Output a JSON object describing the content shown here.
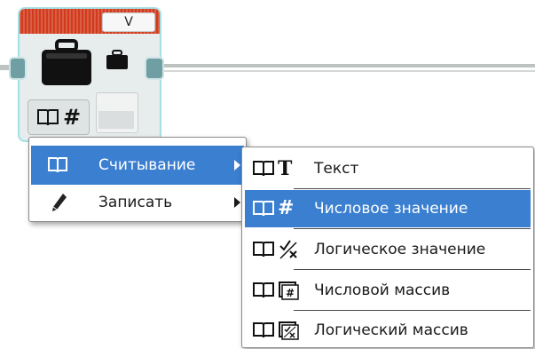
{
  "block": {
    "header_label": "V"
  },
  "menu": {
    "items": [
      {
        "label": "Считывание",
        "icon": "book-icon",
        "has_submenu": true,
        "selected": true
      },
      {
        "label": "Записать",
        "icon": "pencil-icon",
        "has_submenu": true,
        "selected": false
      }
    ]
  },
  "submenu": {
    "items": [
      {
        "label": "Текст",
        "icon": "text-T-icon",
        "selected": false
      },
      {
        "label": "Числовое значение",
        "icon": "hash-icon",
        "selected": true
      },
      {
        "label": "Логическое значение",
        "icon": "logic-check-x-icon",
        "selected": false
      },
      {
        "label": "Числовой массив",
        "icon": "numeric-array-icon",
        "selected": false
      },
      {
        "label": "Логический массив",
        "icon": "logic-array-icon",
        "selected": false
      }
    ]
  },
  "colors": {
    "header": "#d13b1c",
    "selection": "#3b7fd0",
    "port": "#6f9ea3",
    "block_border": "#a8dfe4"
  }
}
